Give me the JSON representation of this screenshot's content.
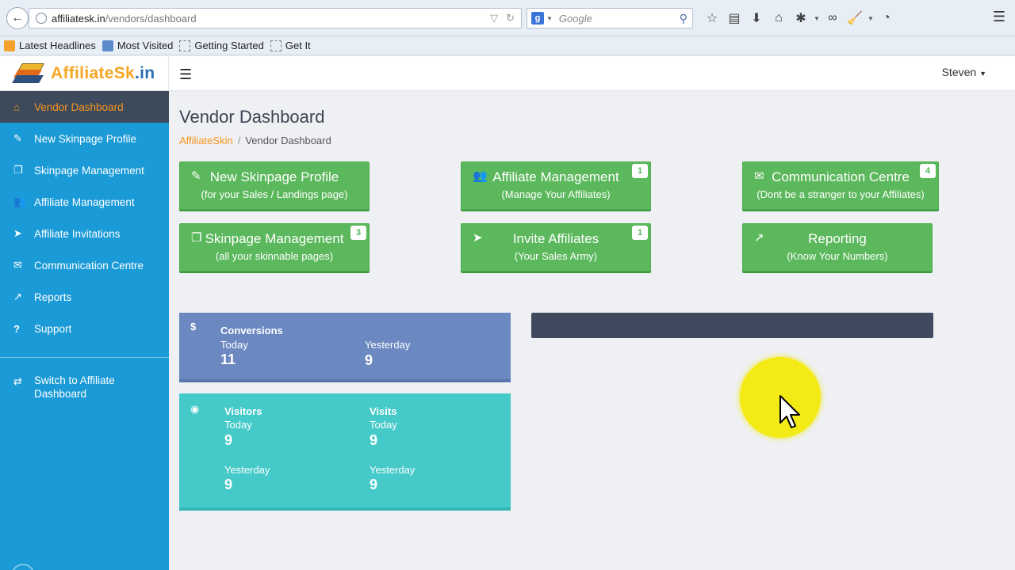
{
  "browser": {
    "url_host": "affiliatesk.in",
    "url_path": "/vendors/dashboard",
    "search_placeholder": "Google",
    "bookmarks": [
      {
        "label": "Latest Headlines",
        "icon": "rss-icon"
      },
      {
        "label": "Most Visited",
        "icon": "most-visited-icon"
      },
      {
        "label": "Getting Started",
        "icon": "page-icon"
      },
      {
        "label": "Get It",
        "icon": "page-icon"
      }
    ]
  },
  "header": {
    "logo_part1": "AffiliateSk",
    "logo_part2": ".in",
    "user": "Steven"
  },
  "sidebar": {
    "items": [
      {
        "label": "Vendor Dashboard",
        "icon": "home-icon",
        "active": true
      },
      {
        "label": "New Skinpage Profile",
        "icon": "edit-icon"
      },
      {
        "label": "Skinpage Management",
        "icon": "copy-icon"
      },
      {
        "label": "Affiliate Management",
        "icon": "users-icon"
      },
      {
        "label": "Affiliate Invitations",
        "icon": "send-icon"
      },
      {
        "label": "Communication Centre",
        "icon": "envelope-icon"
      },
      {
        "label": "Reports",
        "icon": "chart-icon"
      },
      {
        "label": "Support",
        "icon": "question-icon"
      }
    ],
    "switch_label": "Switch to Affiliate Dashboard"
  },
  "main": {
    "title": "Vendor Dashboard",
    "breadcrumb": {
      "link": "AffiliateSkin",
      "sep": "/",
      "current": "Vendor Dashboard"
    },
    "tiles": [
      {
        "title": "New Skinpage Profile",
        "sub": "(for your Sales / Landings page)",
        "icon": "edit-icon",
        "badge": ""
      },
      {
        "title": "Affiliate Management",
        "sub": "(Manage Your Affiliates)",
        "icon": "users-icon",
        "badge": "1"
      },
      {
        "title": "Communication Centre",
        "sub": "(Dont be a stranger to your Affiliates)",
        "icon": "envelope-icon",
        "badge": "4"
      },
      {
        "title": "Skinpage Management",
        "sub": "(all your skinnable pages)",
        "icon": "copy-icon",
        "badge": "3"
      },
      {
        "title": "Invite Affiliates",
        "sub": "(Your Sales Army)",
        "icon": "send-icon",
        "badge": "1"
      },
      {
        "title": "Reporting",
        "sub": "(Know Your Numbers)",
        "icon": "chart-icon",
        "badge": ""
      }
    ],
    "conversions": {
      "symbol": "$",
      "heading": "Conversions",
      "today_label": "Today",
      "today_value": "11",
      "yesterday_label": "Yesterday",
      "yesterday_value": "9"
    },
    "visitors": {
      "heading": "Visitors",
      "today_label": "Today",
      "today_value": "9",
      "yesterday_label": "Yesterday",
      "yesterday_value": "9"
    },
    "visits": {
      "heading": "Visits",
      "today_label": "Today",
      "today_value": "9",
      "yesterday_label": "Yesterday",
      "yesterday_value": "9"
    }
  },
  "colors": {
    "sidebar": "#1a9ad6",
    "accent": "#f7941d",
    "tile": "#5cb85c",
    "conversions": "#6b88c1",
    "visitors": "#45cac9"
  }
}
